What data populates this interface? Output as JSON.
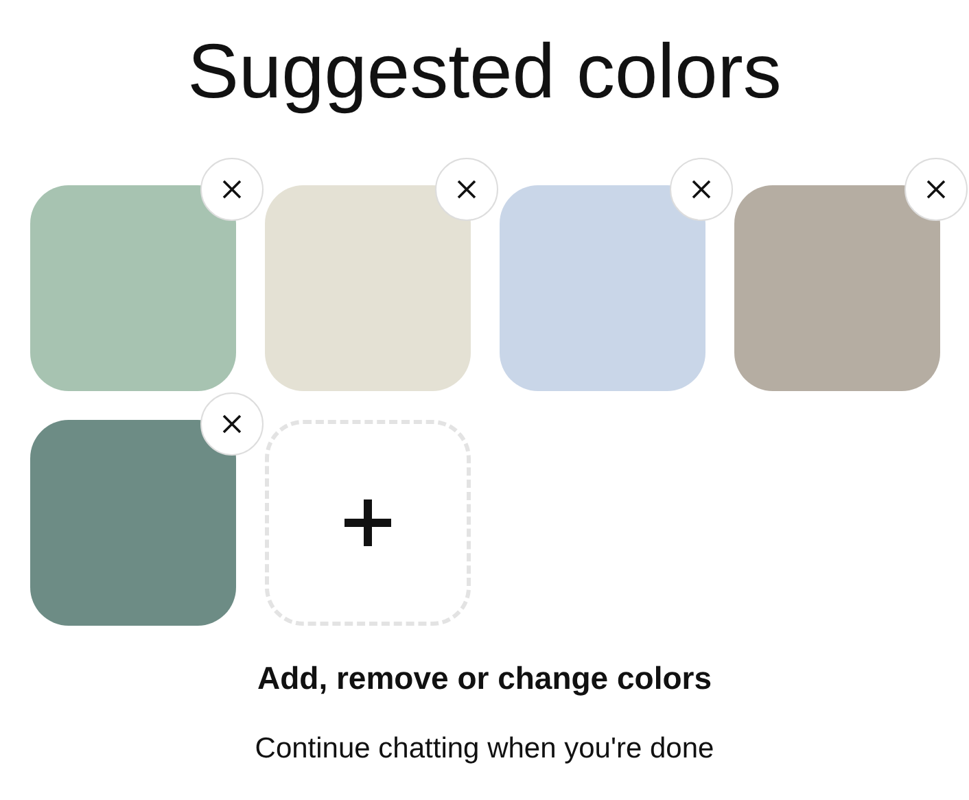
{
  "title": "Suggested colors",
  "swatches": [
    {
      "color": "#a7c3b1"
    },
    {
      "color": "#e4e1d4"
    },
    {
      "color": "#c9d6e8"
    },
    {
      "color": "#b5ada2"
    },
    {
      "color": "#6d8c85"
    }
  ],
  "instruction": "Add, remove or change colors",
  "hint": "Continue chatting when you're done"
}
